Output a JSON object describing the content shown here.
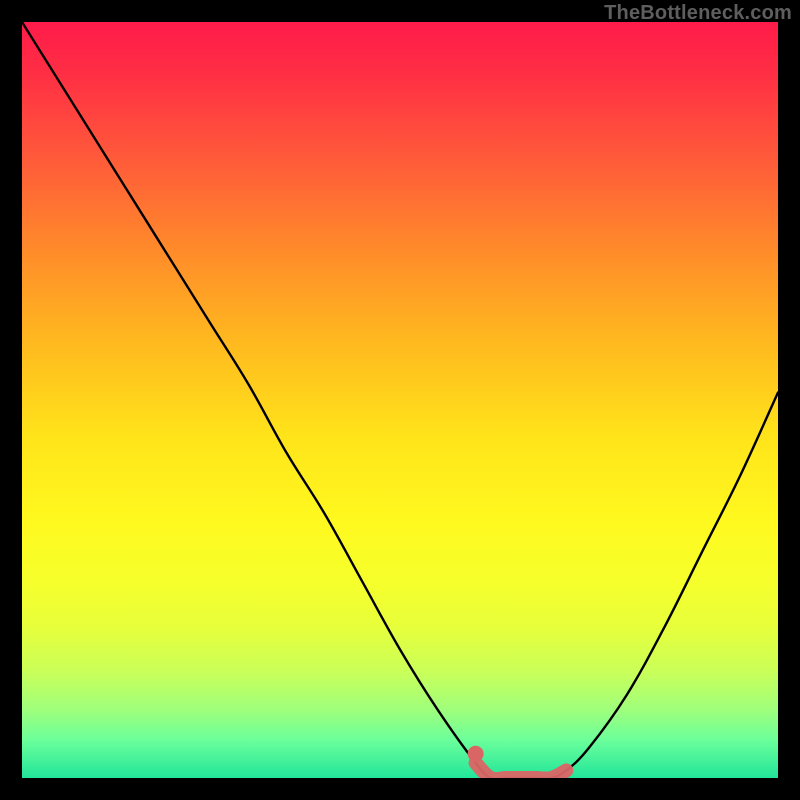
{
  "watermark": {
    "text": "TheBottleneck.com"
  },
  "colors": {
    "gradient_top": "#ff1b4a",
    "gradient_bottom": "#22e59a",
    "curve": "#000000",
    "accent": "#da6565",
    "page_bg": "#000000"
  },
  "chart_data": {
    "type": "line",
    "title": "",
    "xlabel": "",
    "ylabel": "",
    "xlim": [
      0,
      100
    ],
    "ylim": [
      0,
      100
    ],
    "grid": false,
    "legend": false,
    "series": [
      {
        "name": "bottleneck-curve",
        "x": [
          0,
          5,
          10,
          15,
          20,
          25,
          30,
          35,
          40,
          45,
          50,
          55,
          60,
          62,
          64,
          66,
          68,
          70,
          72,
          75,
          80,
          85,
          90,
          95,
          100
        ],
        "y": [
          100,
          92,
          84,
          76,
          68,
          60,
          52,
          43,
          35,
          26,
          17,
          9,
          2,
          0,
          0,
          0,
          0,
          0,
          1,
          4,
          11,
          20,
          30,
          40,
          51
        ]
      }
    ],
    "accent_segment": {
      "name": "optimal-range",
      "x": [
        60,
        62,
        64,
        66,
        68,
        70,
        72
      ],
      "y": [
        2,
        0,
        0,
        0,
        0,
        0,
        1
      ]
    }
  }
}
